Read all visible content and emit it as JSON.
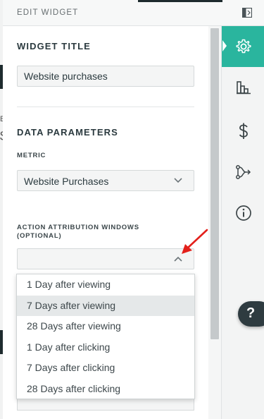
{
  "header": {
    "title": "EDIT WIDGET"
  },
  "widget_title_section": {
    "heading": "WIDGET TITLE",
    "input_value": "Website purchases"
  },
  "data_parameters": {
    "heading": "DATA PARAMETERS",
    "metric_label": "METRIC",
    "metric_value": "Website Purchases",
    "attribution_label": "ACTION ATTRIBUTION WINDOWS (OPTIONAL)",
    "attribution_value": ""
  },
  "attribution_menu": {
    "items": [
      {
        "label": "1 Day after viewing",
        "highlighted": false
      },
      {
        "label": "7 Days after viewing",
        "highlighted": true
      },
      {
        "label": "28 Days after viewing",
        "highlighted": false
      },
      {
        "label": "1 Day after clicking",
        "highlighted": false
      },
      {
        "label": "7 Days after clicking",
        "highlighted": false
      },
      {
        "label": "28 Days after clicking",
        "highlighted": false
      }
    ]
  },
  "rail": {
    "items": [
      {
        "icon": "gear-icon",
        "active": true
      },
      {
        "icon": "bar-chart-icon",
        "active": false
      },
      {
        "icon": "dollar-icon",
        "active": false
      },
      {
        "icon": "branch-icon",
        "active": false
      },
      {
        "icon": "info-icon",
        "active": false
      }
    ],
    "accent_color": "#2ab59e"
  },
  "help": {
    "label": "?"
  },
  "background": {
    "char_e": "E",
    "char_s": "$"
  },
  "colors": {
    "annotation_arrow": "#e3201b",
    "header_dark": "#1e2b2e"
  }
}
